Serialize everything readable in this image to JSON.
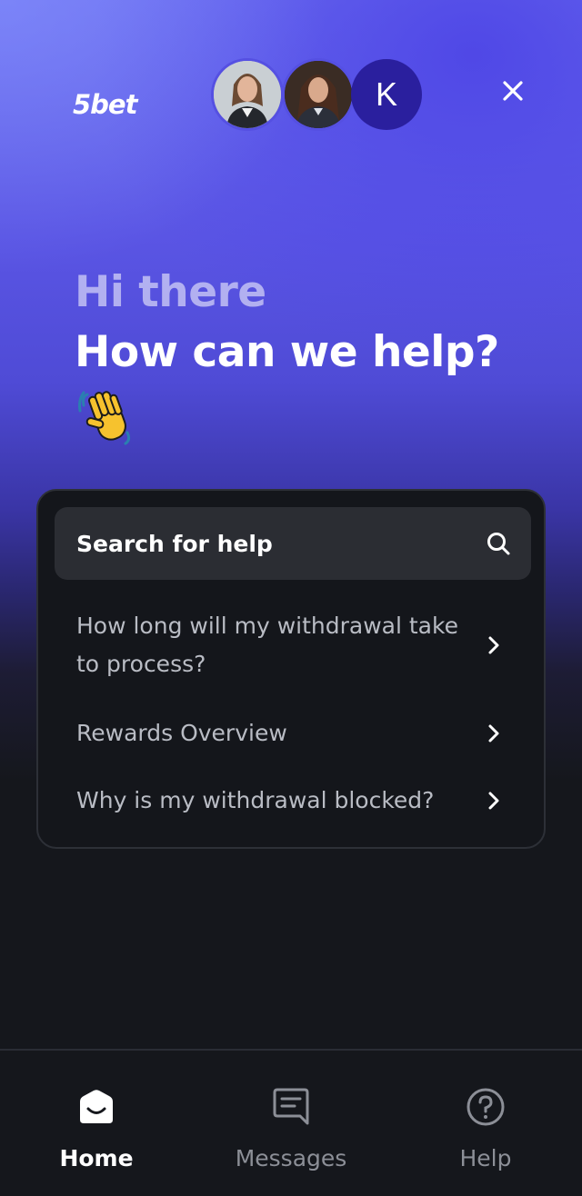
{
  "brand": {
    "logo_text": "5bet"
  },
  "header": {
    "avatars": [
      {
        "name": "agent-photo-1",
        "type": "photo"
      },
      {
        "name": "agent-photo-2",
        "type": "photo"
      },
      {
        "name": "agent-initial",
        "type": "initial",
        "initial": "K",
        "color": "#2a1f9e"
      }
    ],
    "close_icon": "close-icon"
  },
  "hero": {
    "greeting": "Hi there",
    "headline": "How can we help?",
    "emoji": "👋"
  },
  "help_card": {
    "search": {
      "label": "Search for help",
      "icon": "search-icon"
    },
    "articles": [
      {
        "title": "How long will my withdrawal take to process?"
      },
      {
        "title": "Rewards Overview"
      },
      {
        "title": "Why is my withdrawal blocked?"
      }
    ]
  },
  "nav": {
    "items": [
      {
        "label": "Home",
        "icon": "home-icon",
        "active": true
      },
      {
        "label": "Messages",
        "icon": "messages-icon",
        "active": false
      },
      {
        "label": "Help",
        "icon": "help-icon",
        "active": false
      }
    ]
  },
  "colors": {
    "accent": "#5a55e4",
    "background": "#15171c",
    "card": "#14161b",
    "search_field": "#2b2d33",
    "muted_text": "#b9bcc4",
    "inactive_nav": "#8c8f97"
  }
}
